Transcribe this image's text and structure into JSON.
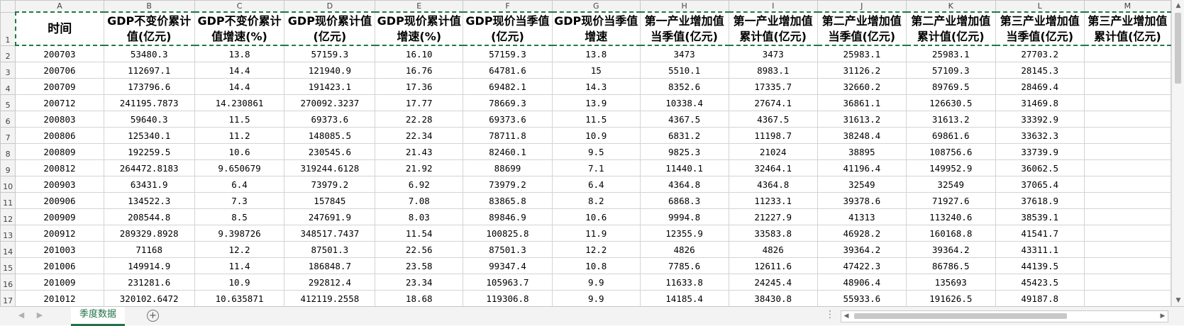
{
  "columns": [
    "A",
    "B",
    "C",
    "D",
    "E",
    "F",
    "G",
    "H",
    "I",
    "J",
    "K",
    "L",
    "M"
  ],
  "header_row": [
    "时间",
    "GDP不变价累计值(亿元)",
    "GDP不变价累计值增速(%)",
    "GDP现价累计值(亿元)",
    "GDP现价累计值增速(%)",
    "GDP现价当季值(亿元)",
    "GDP现价当季值增速",
    "第一产业增加值当季值(亿元)",
    "第一产业增加值累计值(亿元)",
    "第二产业增加值当季值(亿元)",
    "第二产业增加值累计值(亿元)",
    "第三产业增加值当季值(亿元)",
    "第三产业增加值累计值(亿元)"
  ],
  "rows": [
    [
      "200703",
      "53480.3",
      "13.8",
      "57159.3",
      "16.10",
      "57159.3",
      "13.8",
      "3473",
      "3473",
      "25983.1",
      "25983.1",
      "27703.2",
      ""
    ],
    [
      "200706",
      "112697.1",
      "14.4",
      "121940.9",
      "16.76",
      "64781.6",
      "15",
      "5510.1",
      "8983.1",
      "31126.2",
      "57109.3",
      "28145.3",
      ""
    ],
    [
      "200709",
      "173796.6",
      "14.4",
      "191423.1",
      "17.36",
      "69482.1",
      "14.3",
      "8352.6",
      "17335.7",
      "32660.2",
      "89769.5",
      "28469.4",
      ""
    ],
    [
      "200712",
      "241195.7873",
      "14.230861",
      "270092.3237",
      "17.77",
      "78669.3",
      "13.9",
      "10338.4",
      "27674.1",
      "36861.1",
      "126630.5",
      "31469.8",
      ""
    ],
    [
      "200803",
      "59640.3",
      "11.5",
      "69373.6",
      "22.28",
      "69373.6",
      "11.5",
      "4367.5",
      "4367.5",
      "31613.2",
      "31613.2",
      "33392.9",
      ""
    ],
    [
      "200806",
      "125340.1",
      "11.2",
      "148085.5",
      "22.34",
      "78711.8",
      "10.9",
      "6831.2",
      "11198.7",
      "38248.4",
      "69861.6",
      "33632.3",
      ""
    ],
    [
      "200809",
      "192259.5",
      "10.6",
      "230545.6",
      "21.43",
      "82460.1",
      "9.5",
      "9825.3",
      "21024",
      "38895",
      "108756.6",
      "33739.9",
      ""
    ],
    [
      "200812",
      "264472.8183",
      "9.650679",
      "319244.6128",
      "21.92",
      "88699",
      "7.1",
      "11440.1",
      "32464.1",
      "41196.4",
      "149952.9",
      "36062.5",
      ""
    ],
    [
      "200903",
      "63431.9",
      "6.4",
      "73979.2",
      "6.92",
      "73979.2",
      "6.4",
      "4364.8",
      "4364.8",
      "32549",
      "32549",
      "37065.4",
      ""
    ],
    [
      "200906",
      "134522.3",
      "7.3",
      "157845",
      "7.08",
      "83865.8",
      "8.2",
      "6868.3",
      "11233.1",
      "39378.6",
      "71927.6",
      "37618.9",
      ""
    ],
    [
      "200909",
      "208544.8",
      "8.5",
      "247691.9",
      "8.03",
      "89846.9",
      "10.6",
      "9994.8",
      "21227.9",
      "41313",
      "113240.6",
      "38539.1",
      ""
    ],
    [
      "200912",
      "289329.8928",
      "9.398726",
      "348517.7437",
      "11.54",
      "100825.8",
      "11.9",
      "12355.9",
      "33583.8",
      "46928.2",
      "160168.8",
      "41541.7",
      ""
    ],
    [
      "201003",
      "71168",
      "12.2",
      "87501.3",
      "22.56",
      "87501.3",
      "12.2",
      "4826",
      "4826",
      "39364.2",
      "39364.2",
      "43311.1",
      ""
    ],
    [
      "201006",
      "149914.9",
      "11.4",
      "186848.7",
      "23.58",
      "99347.4",
      "10.8",
      "7785.6",
      "12611.6",
      "47422.3",
      "86786.5",
      "44139.5",
      ""
    ],
    [
      "201009",
      "231281.6",
      "10.9",
      "292812.4",
      "23.34",
      "105963.7",
      "9.9",
      "11633.8",
      "24245.4",
      "48906.4",
      "135693",
      "45423.5",
      ""
    ],
    [
      "201012",
      "320102.6472",
      "10.635871",
      "412119.2558",
      "18.68",
      "119306.8",
      "9.9",
      "14185.4",
      "38430.8",
      "55933.6",
      "191626.5",
      "49187.8",
      ""
    ]
  ],
  "sheet_tab": "季度数据",
  "add_sheet": "+",
  "icons": {
    "prev": "◀",
    "next": "▶",
    "up": "▲",
    "down": "▼",
    "dots": "⋮"
  }
}
